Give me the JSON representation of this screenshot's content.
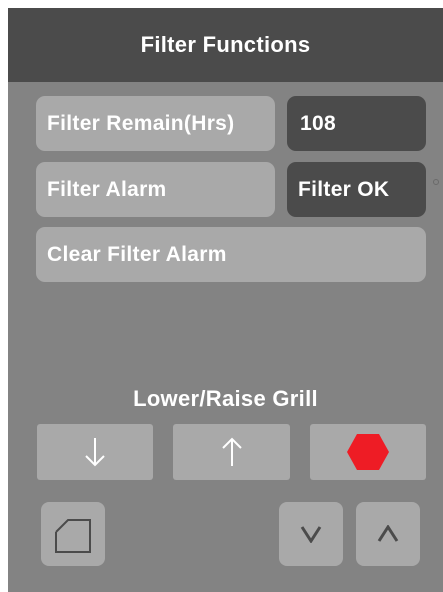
{
  "header": {
    "title": "Filter Functions"
  },
  "filter": {
    "remain_label": "Filter Remain(Hrs)",
    "remain_value": "108",
    "alarm_label": "Filter Alarm",
    "alarm_value": "Filter OK",
    "clear_label": "Clear Filter Alarm"
  },
  "grill": {
    "label": "Lower/Raise Grill",
    "stop_color": "#ee1c25"
  },
  "icons": {
    "lower": "arrow-down-icon",
    "raise": "arrow-up-icon",
    "stop": "stop-hexagon-icon",
    "home": "home-icon",
    "page_down": "chevron-down-icon",
    "page_up": "chevron-up-icon"
  },
  "colors": {
    "panel": "#838383",
    "header": "#4b4b4b",
    "button": "#a9a9a9",
    "value_box": "#4b4b4b",
    "text": "#ffffff"
  }
}
